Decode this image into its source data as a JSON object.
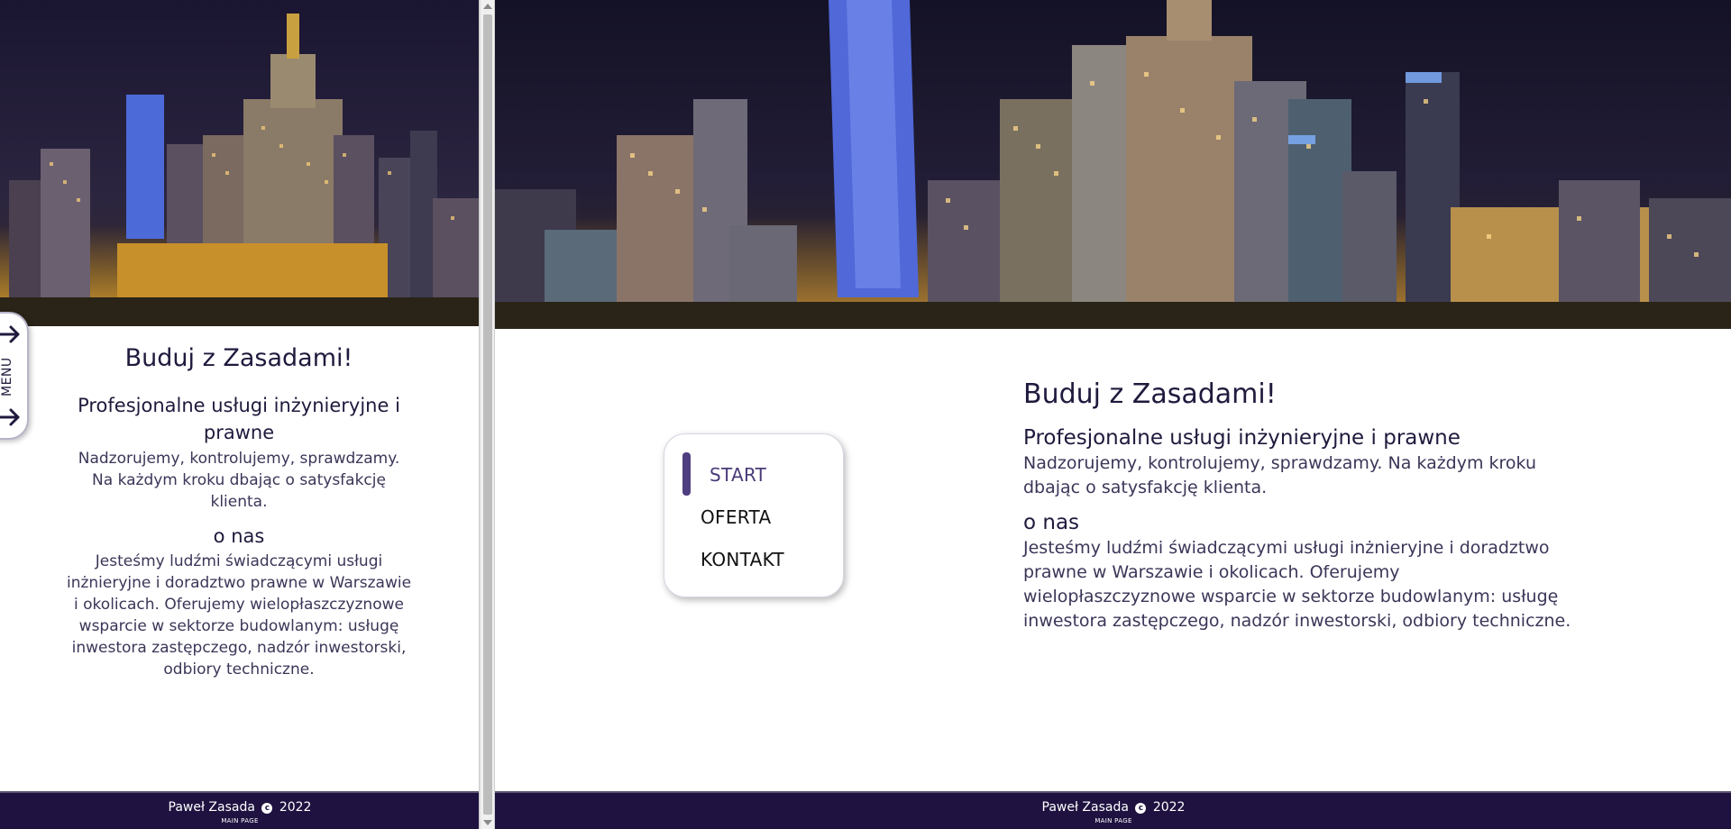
{
  "hero": {
    "image_alt": "Warsaw skyline at night"
  },
  "mobile": {
    "menu_label": "MENU",
    "title": "Buduj z Zasadami!",
    "subtitle": "Profesjonalne usługi inżynieryjne i prawne",
    "intro": "Nadzorujemy, kontrolujemy, sprawdzamy. Na każdym kroku dbając o satysfakcję klienta.",
    "about_heading": "o nas",
    "about_text": "Jesteśmy ludźmi świadczącymi usługi inżnieryjne i doradztwo prawne w Warszawie i okolicach. Oferujemy wielopłaszczyznowe wsparcie w sektorze budowlanym: usługę inwestora zastępczego, nadzór inwestorski, odbiory techniczne."
  },
  "desktop": {
    "nav": [
      "START",
      "OFERTA",
      "KONTAKT"
    ],
    "title": "Buduj z Zasadami!",
    "subtitle": "Profesjonalne usługi inżynieryjne i prawne",
    "intro": "Nadzorujemy, kontrolujemy, sprawdzamy. Na każdym kroku dbając o satysfakcję klienta.",
    "about_heading": "o nas",
    "about_text": "Jesteśmy ludźmi świadczącymi usługi inżnieryjne i doradztwo prawne w Warszawie i okolicach. Oferujemy wielopłaszczyznowe wsparcie w sektorze budowlanym: usługę inwestora zastępczego, nadzór inwestorski, odbiory techniczne."
  },
  "footer": {
    "author": "Paweł Zasada",
    "copyright_symbol": "c",
    "year": "2022",
    "sub": "MAIN PAGE"
  },
  "colors": {
    "accent": "#4f3f80",
    "footer_bg": "#1f1240",
    "text": "#1f1a3d"
  },
  "icons": [
    "arrow-right-icon",
    "copyright-icon"
  ]
}
